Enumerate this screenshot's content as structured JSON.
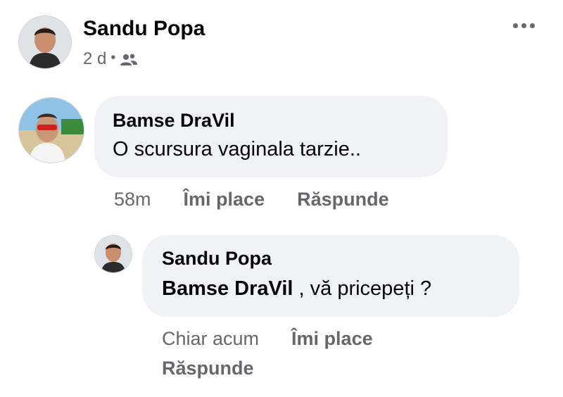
{
  "post": {
    "author": "Sandu Popa",
    "time": "2 d",
    "separator": "•",
    "audience_icon": "friends-icon",
    "more_icon": "more-horizontal-icon"
  },
  "comments": [
    {
      "author": "Bamse DraVil",
      "text": "O scursura vaginala tarzie..",
      "time": "58m",
      "like_label": "Îmi place",
      "reply_label": "Răspunde"
    }
  ],
  "reply": {
    "author": "Sandu Popa",
    "mention": "Bamse DraVil",
    "text": " , vă pricepeți  ?",
    "time": "Chiar acum",
    "like_label": "Îmi place",
    "reply_label": "Răspunde"
  },
  "colors": {
    "bubble_bg": "#f0f2f5",
    "secondary_text": "#65676b",
    "primary_text": "#050505"
  }
}
